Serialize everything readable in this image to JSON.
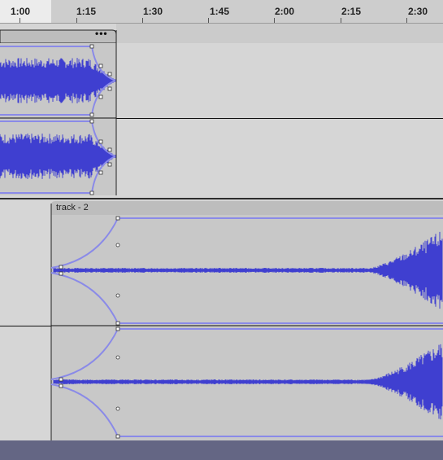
{
  "timeline": {
    "ticks": [
      "1:00",
      "1:15",
      "1:30",
      "1:45",
      "2:00",
      "2:15",
      "2:30"
    ]
  },
  "clip1": {
    "menu_label": "•••"
  },
  "clip2": {
    "name": "track - 2"
  },
  "colors": {
    "waveform": "#3f3fd0",
    "envelope": "#8a8ae8",
    "clip_bg": "#c8c8c8",
    "clip_header": "#bdbdbd",
    "track_bg": "#d6d6d6",
    "bottom_bar": "#646684"
  },
  "icons": {
    "clip1_menu": "ellipsis-icon"
  }
}
